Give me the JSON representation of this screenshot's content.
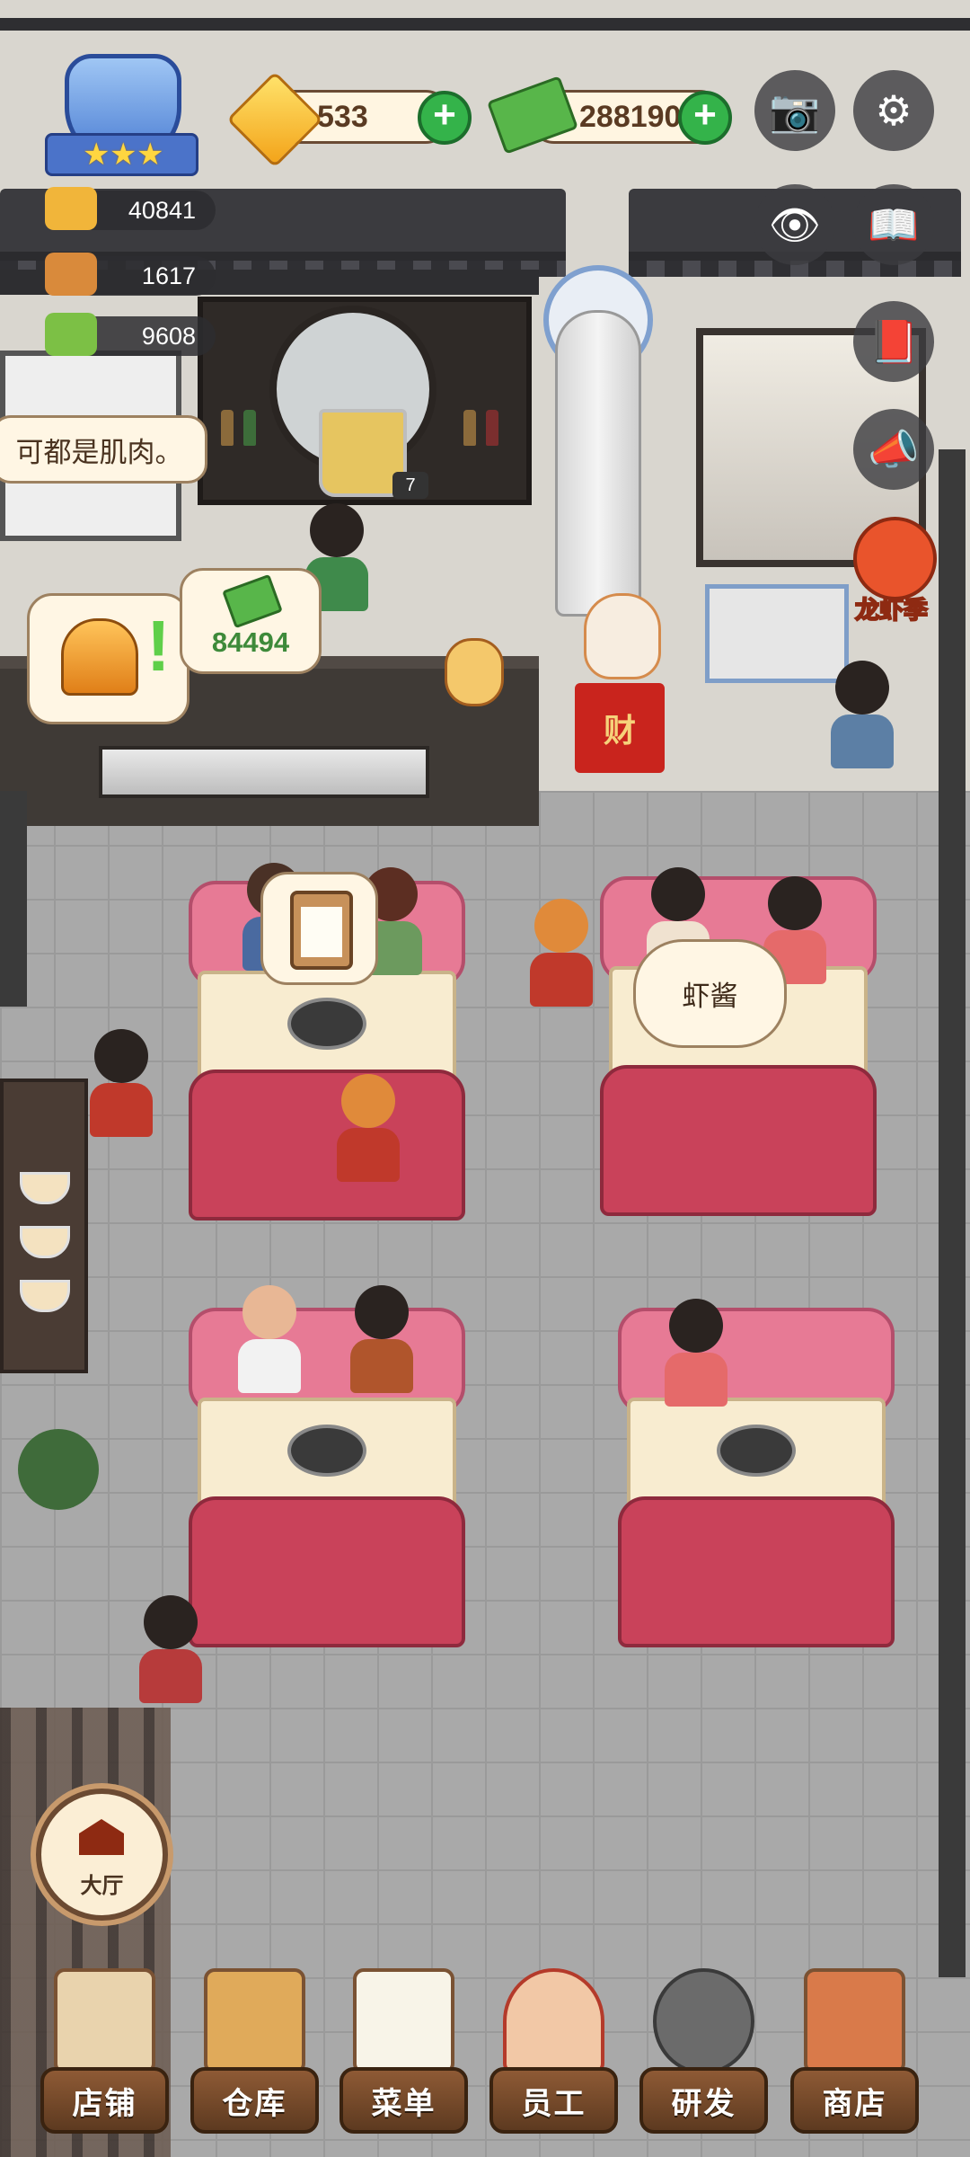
{
  "hud": {
    "gems": "533",
    "cash": "288190",
    "stats": [
      {
        "name": "fame",
        "value": "40841"
      },
      {
        "name": "dishes",
        "value": "1617"
      },
      {
        "name": "menu",
        "value": "9608"
      }
    ],
    "badge_stars": 3
  },
  "scene": {
    "speech_text": "可都是肌肉。",
    "counter_income": "84494",
    "drink_count": "7",
    "order_text": "虾酱",
    "fortune_char": "财"
  },
  "event": {
    "label": "龙虾季"
  },
  "hall_button": {
    "label": "大厅"
  },
  "nav": [
    {
      "label": "店铺"
    },
    {
      "label": "仓库"
    },
    {
      "label": "菜单"
    },
    {
      "label": "员工"
    },
    {
      "label": "研发"
    },
    {
      "label": "商店"
    }
  ],
  "colors": {
    "plus_green": "#34b34a",
    "sofa_pink": "#e77a95",
    "sofa_red": "#c9425a",
    "nav_wood": "#8e5a35"
  }
}
